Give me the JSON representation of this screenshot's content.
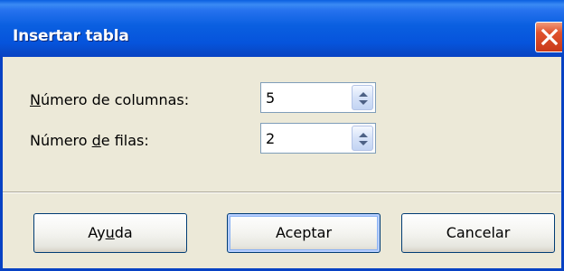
{
  "window": {
    "title": "Insertar tabla",
    "close_icon": "close-x-icon"
  },
  "fields": {
    "columns": {
      "label_prefix": "",
      "label_mnemonic": "N",
      "label_rest": "úmero de columnas:",
      "value": "5"
    },
    "rows": {
      "label_prefix": "Número ",
      "label_mnemonic": "d",
      "label_rest": "e filas:",
      "value": "2"
    }
  },
  "buttons": {
    "help": {
      "prefix": "Ay",
      "mnemonic": "u",
      "rest": "da"
    },
    "ok": {
      "label": "Aceptar"
    },
    "cancel": {
      "label": "Cancelar"
    }
  },
  "colors": {
    "title_bar": "#0a5fe0",
    "close_button": "#e0522d",
    "dialog_bg": "#ece9d8",
    "button_border": "#003c74"
  }
}
